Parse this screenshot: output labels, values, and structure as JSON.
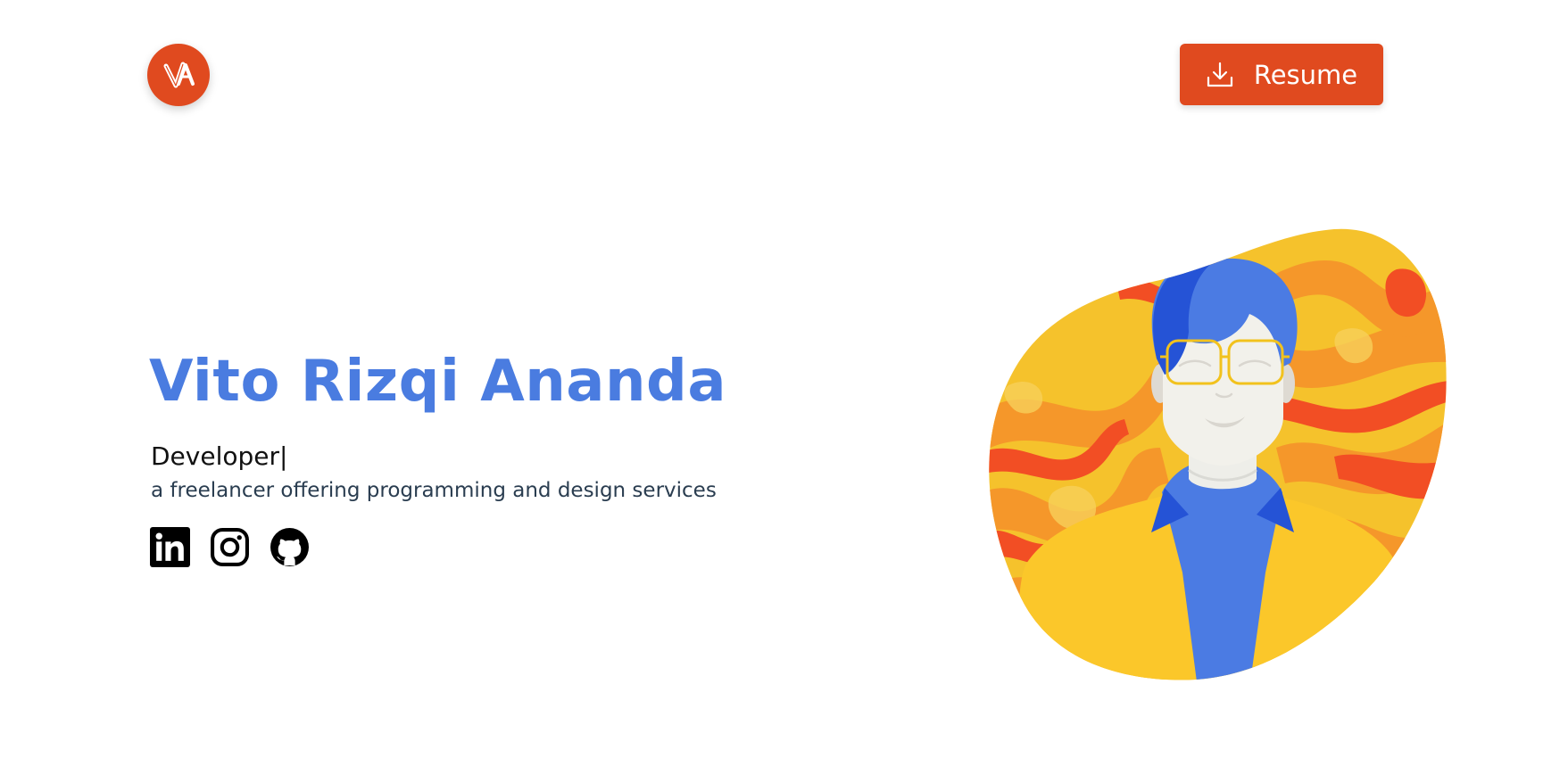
{
  "header": {
    "logo_icon": "va-monogram-logo",
    "resume": {
      "label": "Resume",
      "icon": "download-icon"
    }
  },
  "hero": {
    "name": "Vito Rizqi Ananda",
    "role": "Developer",
    "caret": "|",
    "tagline": "a freelancer offering programming and design services"
  },
  "socials": [
    {
      "icon": "linkedin-icon"
    },
    {
      "icon": "instagram-icon"
    },
    {
      "icon": "github-icon"
    }
  ],
  "illustration": {
    "icon": "developer-avatar-illustration"
  },
  "colors": {
    "accent": "#e04a1f",
    "name": "#4a7ce0",
    "text": "#111111",
    "tagline": "#2a3d50",
    "blob_base": "#f5c22c",
    "blob_orange": "#f5972a",
    "blob_red": "#f24e24"
  }
}
